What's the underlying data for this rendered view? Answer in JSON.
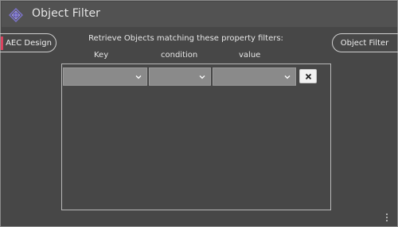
{
  "window": {
    "title": "Object Filter",
    "app_icon": "diamond-logo-icon"
  },
  "left_button": {
    "label": "AEC Design",
    "accent_color": "#d8435f"
  },
  "right_button": {
    "label": "Object Filter"
  },
  "instructions": "Retrieve Objects matching these property filters:",
  "columns": {
    "key": "Key",
    "condition": "condition",
    "value": "value"
  },
  "filter_rows": [
    {
      "key": "",
      "condition": "",
      "value": ""
    }
  ],
  "icons": {
    "dropdown": "chevron-down-icon",
    "remove": "close-icon",
    "menu": "more-vertical-icon"
  },
  "colors": {
    "background": "#474747",
    "titlebar": "#525252",
    "select_fill": "#8a8a8a",
    "text": "#e6e6e6"
  }
}
